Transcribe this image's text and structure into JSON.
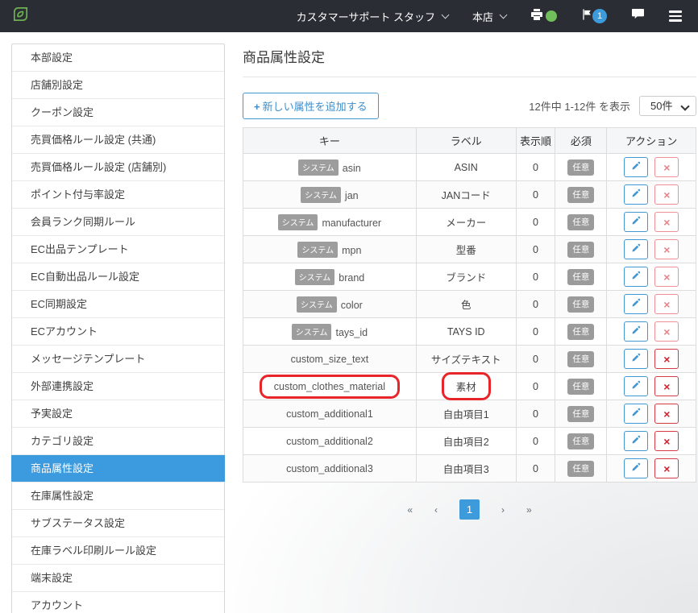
{
  "navbar": {
    "user_menu": "カスタマーサポート スタッフ",
    "store_menu": "本店",
    "flag_badge_count": "1"
  },
  "sidebar": {
    "items": [
      {
        "label": "本部設定",
        "active": false
      },
      {
        "label": "店舗別設定",
        "active": false
      },
      {
        "label": "クーポン設定",
        "active": false
      },
      {
        "label": "売買価格ルール設定 (共通)",
        "active": false
      },
      {
        "label": "売買価格ルール設定 (店舗別)",
        "active": false
      },
      {
        "label": "ポイント付与率設定",
        "active": false
      },
      {
        "label": "会員ランク同期ルール",
        "active": false
      },
      {
        "label": "EC出品テンプレート",
        "active": false
      },
      {
        "label": "EC自動出品ルール設定",
        "active": false
      },
      {
        "label": "EC同期設定",
        "active": false
      },
      {
        "label": "ECアカウント",
        "active": false
      },
      {
        "label": "メッセージテンプレート",
        "active": false
      },
      {
        "label": "外部連携設定",
        "active": false
      },
      {
        "label": "予実設定",
        "active": false
      },
      {
        "label": "カテゴリ設定",
        "active": false
      },
      {
        "label": "商品属性設定",
        "active": true
      },
      {
        "label": "在庫属性設定",
        "active": false
      },
      {
        "label": "サブステータス設定",
        "active": false
      },
      {
        "label": "在庫ラベル印刷ルール設定",
        "active": false
      },
      {
        "label": "端末設定",
        "active": false
      },
      {
        "label": "アカウント",
        "active": false
      }
    ]
  },
  "main": {
    "title": "商品属性設定",
    "add_button_plus": "+",
    "add_button_label": "新しい属性を追加する",
    "result_summary": "12件中 1-12件 を表示",
    "page_size": "50件",
    "table": {
      "headers": [
        "キー",
        "ラベル",
        "表示順",
        "必須",
        "アクション"
      ],
      "system_badge": "システム",
      "rows": [
        {
          "key": "asin",
          "system": true,
          "label": "ASIN",
          "order": "0",
          "required": "任意",
          "deletable": false,
          "highlight": false
        },
        {
          "key": "jan",
          "system": true,
          "label": "JANコード",
          "order": "0",
          "required": "任意",
          "deletable": false,
          "highlight": false
        },
        {
          "key": "manufacturer",
          "system": true,
          "label": "メーカー",
          "order": "0",
          "required": "任意",
          "deletable": false,
          "highlight": false
        },
        {
          "key": "mpn",
          "system": true,
          "label": "型番",
          "order": "0",
          "required": "任意",
          "deletable": false,
          "highlight": false
        },
        {
          "key": "brand",
          "system": true,
          "label": "ブランド",
          "order": "0",
          "required": "任意",
          "deletable": false,
          "highlight": false
        },
        {
          "key": "color",
          "system": true,
          "label": "色",
          "order": "0",
          "required": "任意",
          "deletable": false,
          "highlight": false
        },
        {
          "key": "tays_id",
          "system": true,
          "label": "TAYS ID",
          "order": "0",
          "required": "任意",
          "deletable": false,
          "highlight": false
        },
        {
          "key": "custom_size_text",
          "system": false,
          "label": "サイズテキスト",
          "order": "0",
          "required": "任意",
          "deletable": true,
          "highlight": false
        },
        {
          "key": "custom_clothes_material",
          "system": false,
          "label": "素材",
          "order": "0",
          "required": "任意",
          "deletable": true,
          "highlight": true
        },
        {
          "key": "custom_additional1",
          "system": false,
          "label": "自由項目1",
          "order": "0",
          "required": "任意",
          "deletable": true,
          "highlight": false
        },
        {
          "key": "custom_additional2",
          "system": false,
          "label": "自由項目2",
          "order": "0",
          "required": "任意",
          "deletable": true,
          "highlight": false
        },
        {
          "key": "custom_additional3",
          "system": false,
          "label": "自由項目3",
          "order": "0",
          "required": "任意",
          "deletable": true,
          "highlight": false
        }
      ]
    },
    "pagination": {
      "first": "«",
      "prev": "‹",
      "current": "1",
      "next": "›",
      "last": "»"
    }
  },
  "colors": {
    "accent_blue": "#3d9bdb",
    "annotation_red": "#e8262a",
    "online_green": "#71bf5b",
    "navbar_dark": "#2a2e34"
  },
  "icons": {
    "logo": "leaf-logo",
    "nav": [
      "printer-icon",
      "online-dot",
      "flag-icon",
      "chat-icon",
      "hamburger-icon"
    ],
    "actions": [
      "pencil-icon",
      "x-icon"
    ]
  }
}
